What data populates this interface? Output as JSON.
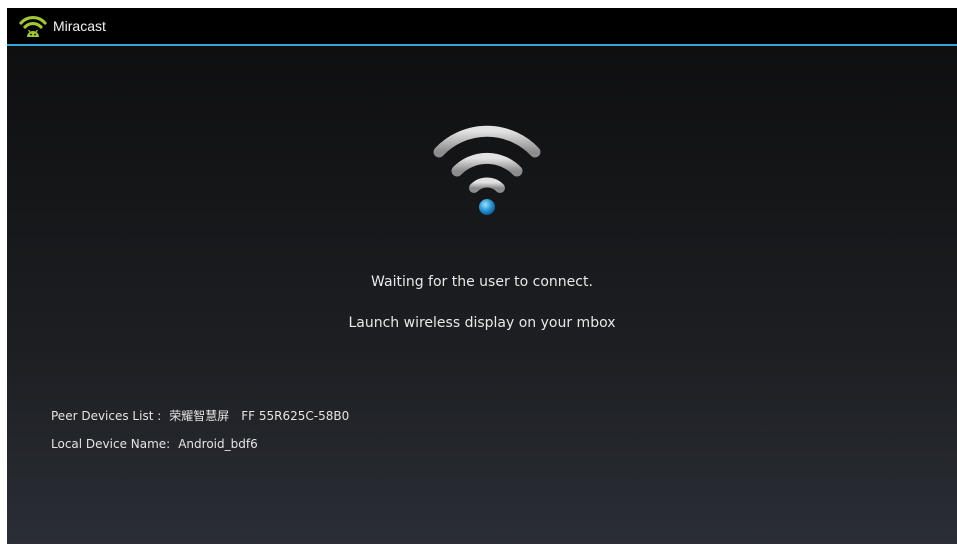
{
  "app": {
    "title": "Miracast",
    "icon": "wifi-android-icon",
    "accent_color": "#35a6d6"
  },
  "main": {
    "status_icon": "wifi-signal-icon",
    "waiting_text": "Waiting for the user to connect.",
    "launch_text": "Launch wireless display on your mbox"
  },
  "info": {
    "peer_label": "Peer Devices List :",
    "peer_name": "荣耀智慧屏",
    "peer_id": "FF 55R625C-58B0",
    "local_label": "Local Device Name:",
    "local_name": "Android_bdf6"
  }
}
